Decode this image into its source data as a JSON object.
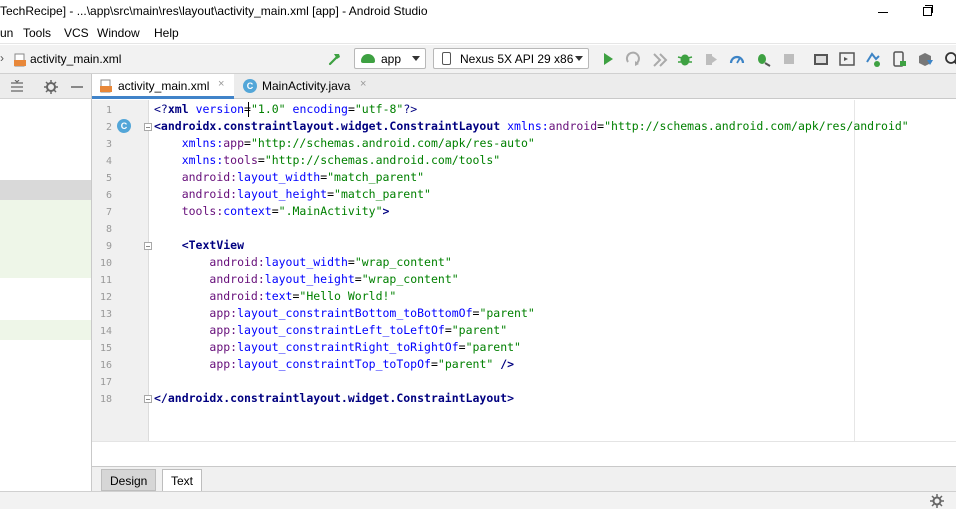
{
  "window": {
    "title": "TechRecipe] - ...\\app\\src\\main\\res\\layout\\activity_main.xml [app] - Android Studio"
  },
  "menu": {
    "items": [
      "un",
      "Tools",
      "VCS",
      "Window",
      "Help"
    ]
  },
  "navbar": {
    "crumb_separator": "›",
    "file": "activity_main.xml",
    "module_combo": "app",
    "device_combo": "Nexus 5X API 29 x86"
  },
  "tabs": [
    {
      "label": "activity_main.xml",
      "close": "×",
      "active": true
    },
    {
      "label": "MainActivity.java",
      "close": "×",
      "active": false,
      "icon_letter": "C"
    }
  ],
  "gutter": {
    "line_numbers": [
      "1",
      "2",
      "3",
      "4",
      "5",
      "6",
      "7",
      "8",
      "9",
      "10",
      "11",
      "12",
      "13",
      "14",
      "15",
      "16",
      "17",
      "18"
    ],
    "class_icon_letter": "C"
  },
  "code": {
    "l1": {
      "pi_open": "<?",
      "pi_name": "xml",
      "a1": "version",
      "v1": "\"1.0\"",
      "a2": "encoding",
      "v2": "\"utf-8\"",
      "pi_close": "?>"
    },
    "l2": {
      "open": "<androidx.constraintlayout.widget.ConstraintLayout",
      "ns": "xmlns:",
      "attr": "android",
      "val": "\"http://schemas.android.com/apk/res/android\""
    },
    "l3": {
      "ns": "xmlns:",
      "attr": "app",
      "val": "\"http://schemas.android.com/apk/res-auto\""
    },
    "l4": {
      "ns": "xmlns:",
      "attr": "tools",
      "val": "\"http://schemas.android.com/tools\""
    },
    "l5": {
      "ns": "android:",
      "attr": "layout_width",
      "val": "\"match_parent\""
    },
    "l6": {
      "ns": "android:",
      "attr": "layout_height",
      "val": "\"match_parent\""
    },
    "l7": {
      "ns": "tools:",
      "attr": "context",
      "val": "\".MainActivity\"",
      "close": ">"
    },
    "l9": {
      "open": "<TextView"
    },
    "l10": {
      "ns": "android:",
      "attr": "layout_width",
      "val": "\"wrap_content\""
    },
    "l11": {
      "ns": "android:",
      "attr": "layout_height",
      "val": "\"wrap_content\""
    },
    "l12": {
      "ns": "android:",
      "attr": "text",
      "val": "\"Hello World!\""
    },
    "l13": {
      "ns": "app:",
      "attr": "layout_constraintBottom_toBottomOf",
      "val": "\"parent\""
    },
    "l14": {
      "ns": "app:",
      "attr": "layout_constraintLeft_toLeftOf",
      "val": "\"parent\""
    },
    "l15": {
      "ns": "app:",
      "attr": "layout_constraintRight_toRightOf",
      "val": "\"parent\""
    },
    "l16": {
      "ns": "app:",
      "attr": "layout_constraintTop_toTopOf",
      "val": "\"parent\"",
      "close": " />"
    },
    "l18": {
      "close_tag": "</androidx.constraintlayout.widget.ConstraintLayout>"
    }
  },
  "bottom_tabs": {
    "design": "Design",
    "text": "Text"
  },
  "icons": {
    "build": "hammer-icon",
    "run": "run-icon",
    "apply_changes": "apply-changes-icon",
    "debug": "debug-icon",
    "profile": "profile-icon",
    "attach_debugger": "attach-debugger-icon",
    "stop": "stop-icon",
    "sync": "sync-gradle-icon",
    "avd": "avd-manager-icon",
    "sdk": "sdk-manager-icon",
    "search": "search-icon",
    "settings": "gear-icon"
  },
  "colors": {
    "tag": "#000080",
    "namespace": "#660e7a",
    "attribute": "#0000ff",
    "value": "#008000",
    "active_tab_underline": "#4083c9",
    "run_green": "#3ea142"
  }
}
